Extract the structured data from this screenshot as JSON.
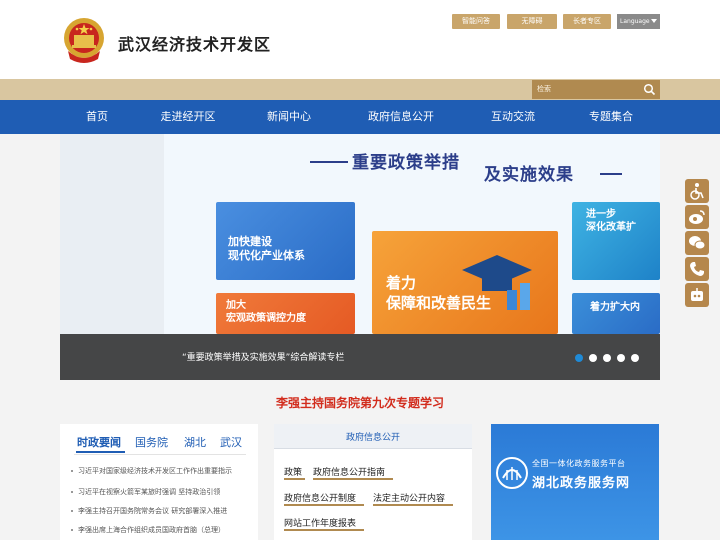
{
  "header": {
    "site_title": "武汉经济技术开发区",
    "top_links": [
      "智能问答",
      "无障碍",
      "长者专区"
    ],
    "language": "Language",
    "search_placeholder": "检索"
  },
  "nav": [
    "首页",
    "走进经开区",
    "新闻中心",
    "政府信息公开",
    "互动交流",
    "专题集合"
  ],
  "banner": {
    "title_line1": "重要政策举措",
    "title_line2": "及实施效果",
    "cards": [
      {
        "text": "加快建设\n现代化产业体系"
      },
      {
        "text": "着力\n保障和改善民生"
      },
      {
        "text": "进一步\n深化改革扩"
      },
      {
        "text": "加大\n宏观政策调控力度"
      },
      {
        "text": "着力扩大内"
      }
    ],
    "caption": "“重要政策举措及实施效果”综合解读专栏",
    "slides": 5,
    "active_slide": 1
  },
  "headline": "李强主持国务院第九次专题学习",
  "news": {
    "tabs": [
      "时政要闻",
      "国务院",
      "湖北",
      "武汉"
    ],
    "items": [
      "习近平对国家级经济技术开发区工作作出重要指示",
      "习近平在视察火箭军某旅时强调 坚持政治引领",
      "李强主持召开国务院常务会议 研究部署深入推进",
      "李强出席上海合作组织成员国政府首脑（总理）"
    ]
  },
  "gov_info": {
    "title": "政府信息公开",
    "links": [
      "政策",
      "政府信息公开指南",
      "政府信息公开制度",
      "法定主动公开内容",
      "网站工作年度报表"
    ]
  },
  "service": {
    "line1": "全国一体化政务服务平台",
    "line2": "湖北政务服务网"
  },
  "colors": {
    "nav_blue": "#1f5db4",
    "gold": "#b08a50",
    "headline_red": "#d22c1d"
  }
}
